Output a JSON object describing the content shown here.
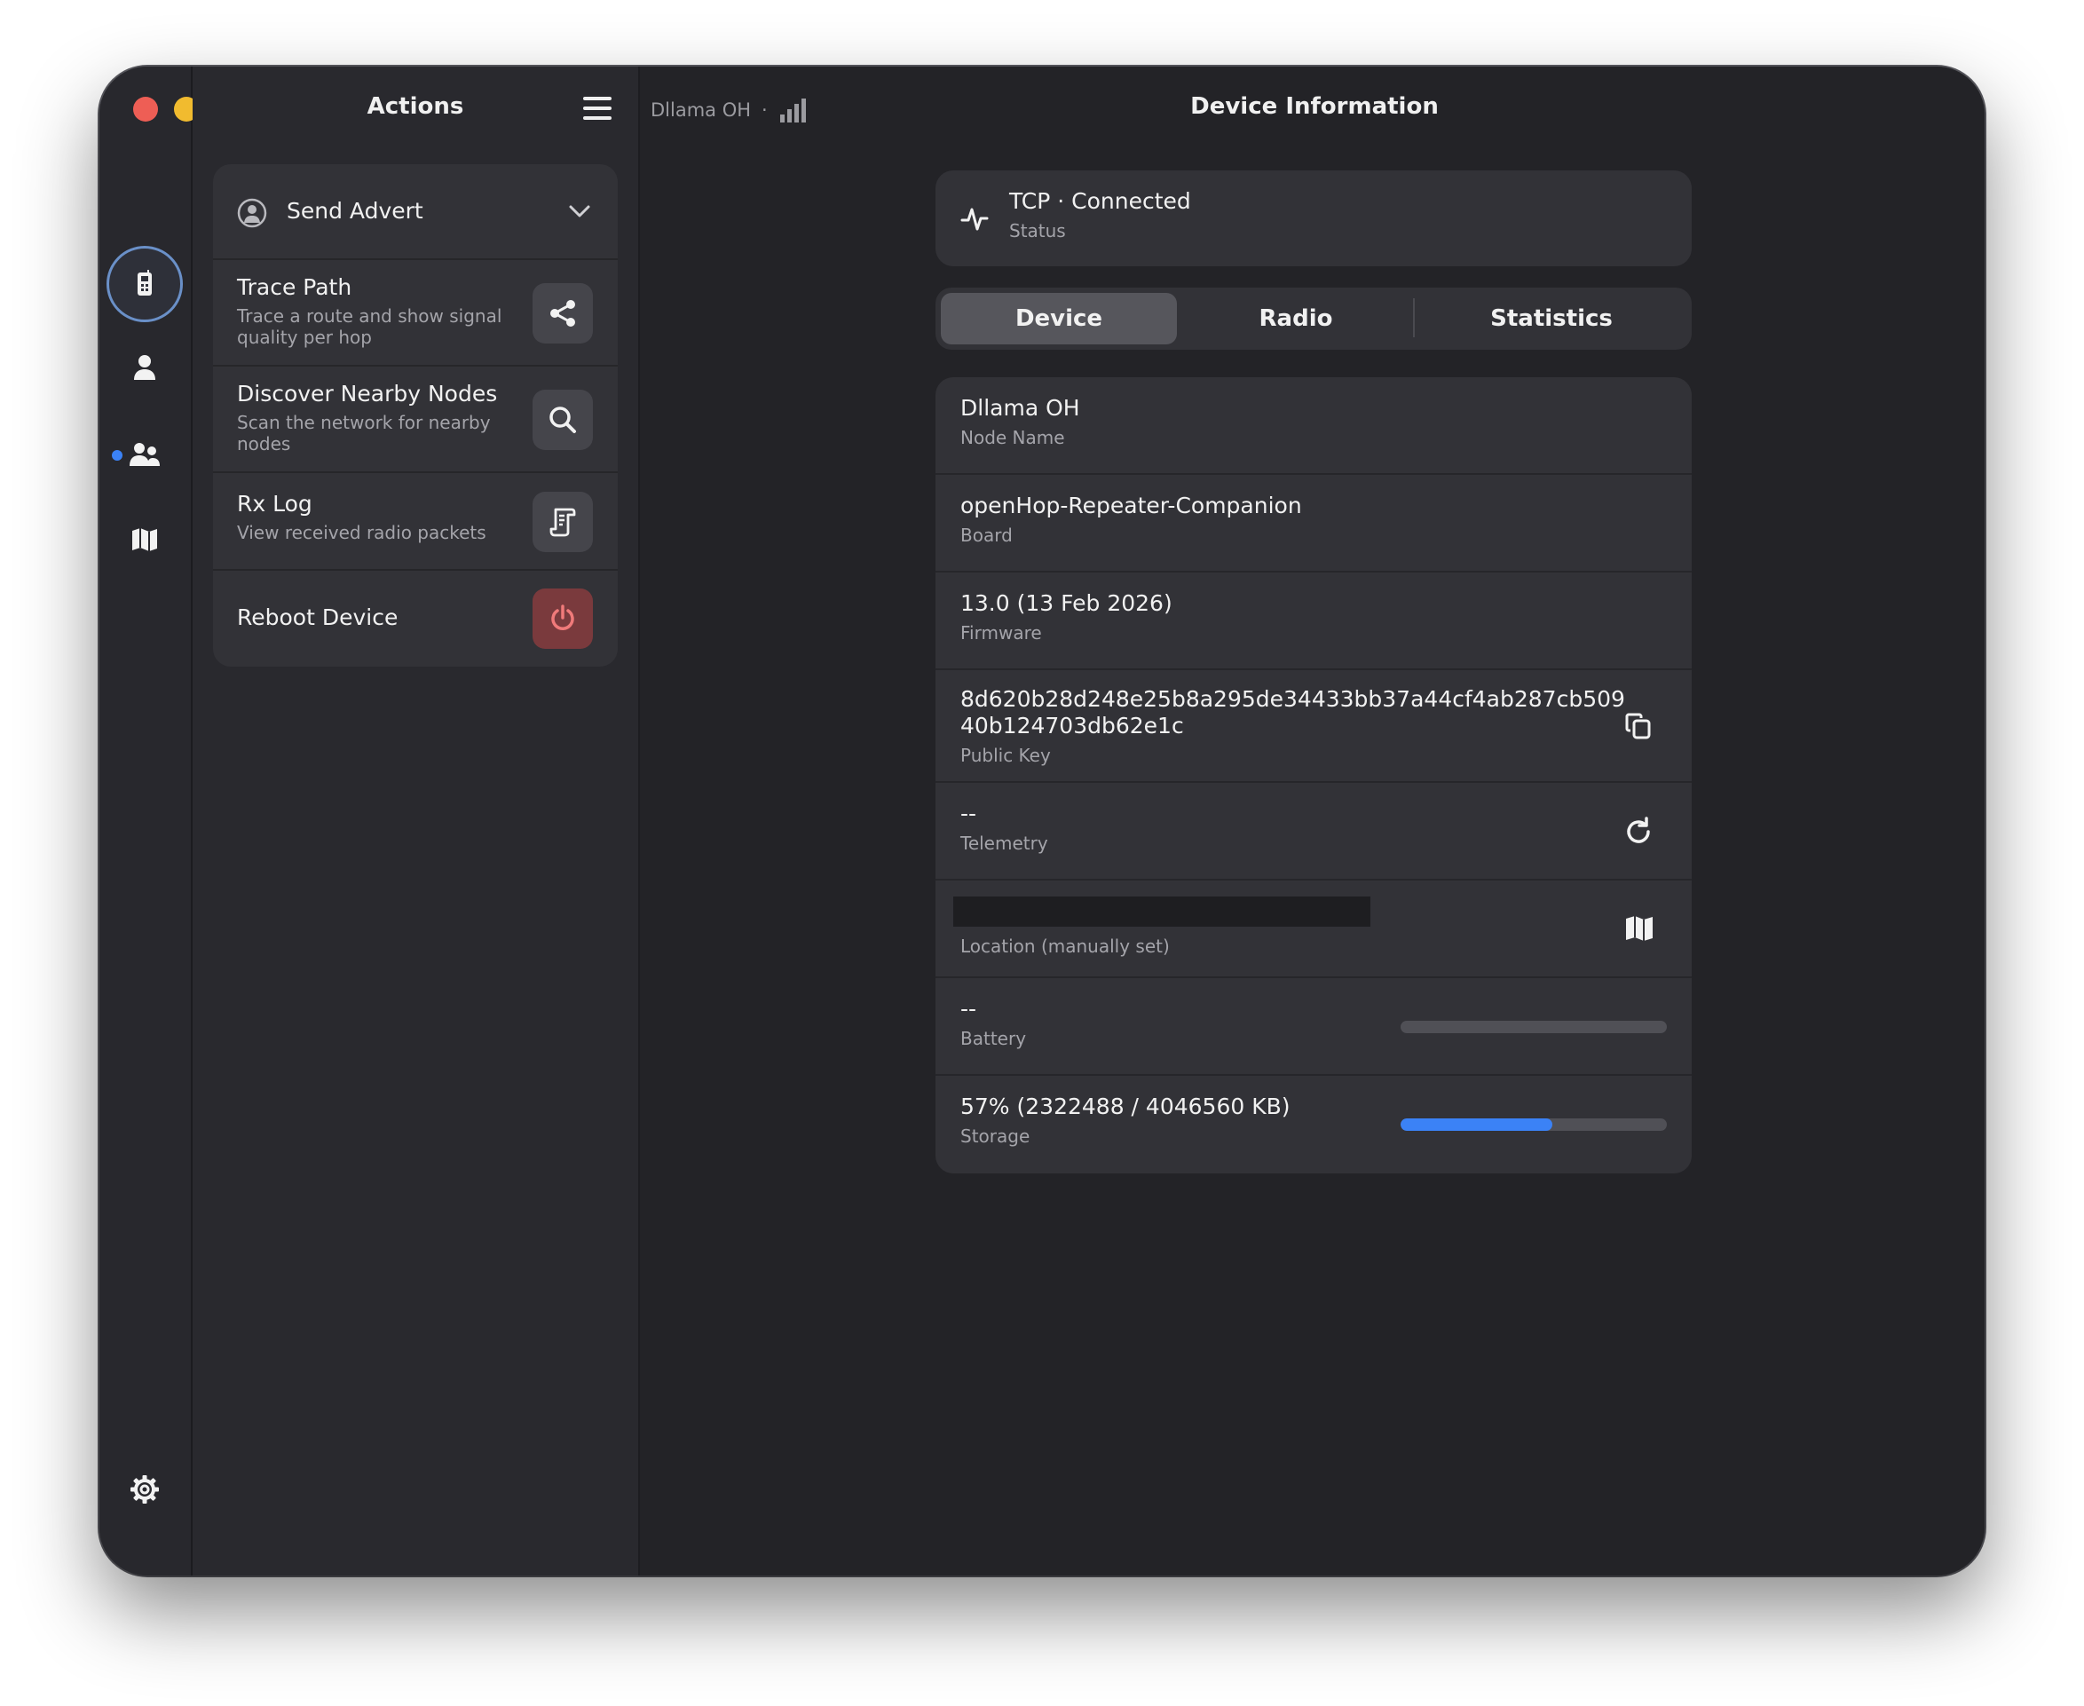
{
  "window": {
    "traffic_lights": {
      "close_color": "#ee5e55",
      "minimize_color": "#f1bb2f",
      "zoom_color": "#5fc453"
    }
  },
  "rail": {
    "items": [
      {
        "name": "device",
        "icon": "device-icon",
        "active": true
      },
      {
        "name": "contacts",
        "icon": "person-icon",
        "active": false
      },
      {
        "name": "channels",
        "icon": "people-icon",
        "active": false,
        "has_unread_dot": true
      },
      {
        "name": "map",
        "icon": "map-icon",
        "active": false
      }
    ],
    "settings_icon": "gear-icon"
  },
  "actions": {
    "title": "Actions",
    "menu_icon": "hamburger-icon",
    "items": [
      {
        "title": "Send Advert",
        "subtitle": "",
        "icon": "broadcast-icon",
        "trailing": "chevron-down-icon"
      },
      {
        "title": "Trace Path",
        "subtitle": "Trace a route and show signal quality per hop",
        "button_icon": "share-icon"
      },
      {
        "title": "Discover Nearby Nodes",
        "subtitle": "Scan the network for nearby nodes",
        "button_icon": "search-icon"
      },
      {
        "title": "Rx Log",
        "subtitle": "View received radio packets",
        "button_icon": "log-icon"
      },
      {
        "title": "Reboot Device",
        "subtitle": "",
        "button_icon": "power-icon",
        "danger": true
      }
    ]
  },
  "header": {
    "node_name": "Dllama OH",
    "separator": "·",
    "signal_icon": "signal-bars-icon",
    "title": "Device Information"
  },
  "status": {
    "value": "TCP · Connected",
    "label": "Status",
    "icon": "activity-icon"
  },
  "tabs": [
    {
      "label": "Device",
      "active": true
    },
    {
      "label": "Radio",
      "active": false
    },
    {
      "label": "Statistics",
      "active": false
    }
  ],
  "device_info": {
    "node_name": {
      "value": "Dllama OH",
      "label": "Node Name"
    },
    "board": {
      "value": "openHop-Repeater-Companion",
      "label": "Board"
    },
    "firmware": {
      "value": "13.0 (13 Feb 2026)",
      "label": "Firmware"
    },
    "public_key": {
      "value_line1": "8d620b28d248e25b8a295de34433bb37a44cf4ab287cb509",
      "value_line2": "40b124703db62e1c",
      "label": "Public Key",
      "action_icon": "copy-icon"
    },
    "telemetry": {
      "value": "--",
      "label": "Telemetry",
      "action_icon": "refresh-icon"
    },
    "location": {
      "value": "",
      "label": "Location (manually set)",
      "action_icon": "map-icon"
    },
    "battery": {
      "value": "--",
      "label": "Battery",
      "level": 0
    },
    "storage": {
      "value": "57% (2322488 / 4046560 KB)",
      "label": "Storage",
      "level": 0.57
    }
  },
  "colors": {
    "accent": "#3b82f6",
    "danger": "#e25a5a"
  }
}
